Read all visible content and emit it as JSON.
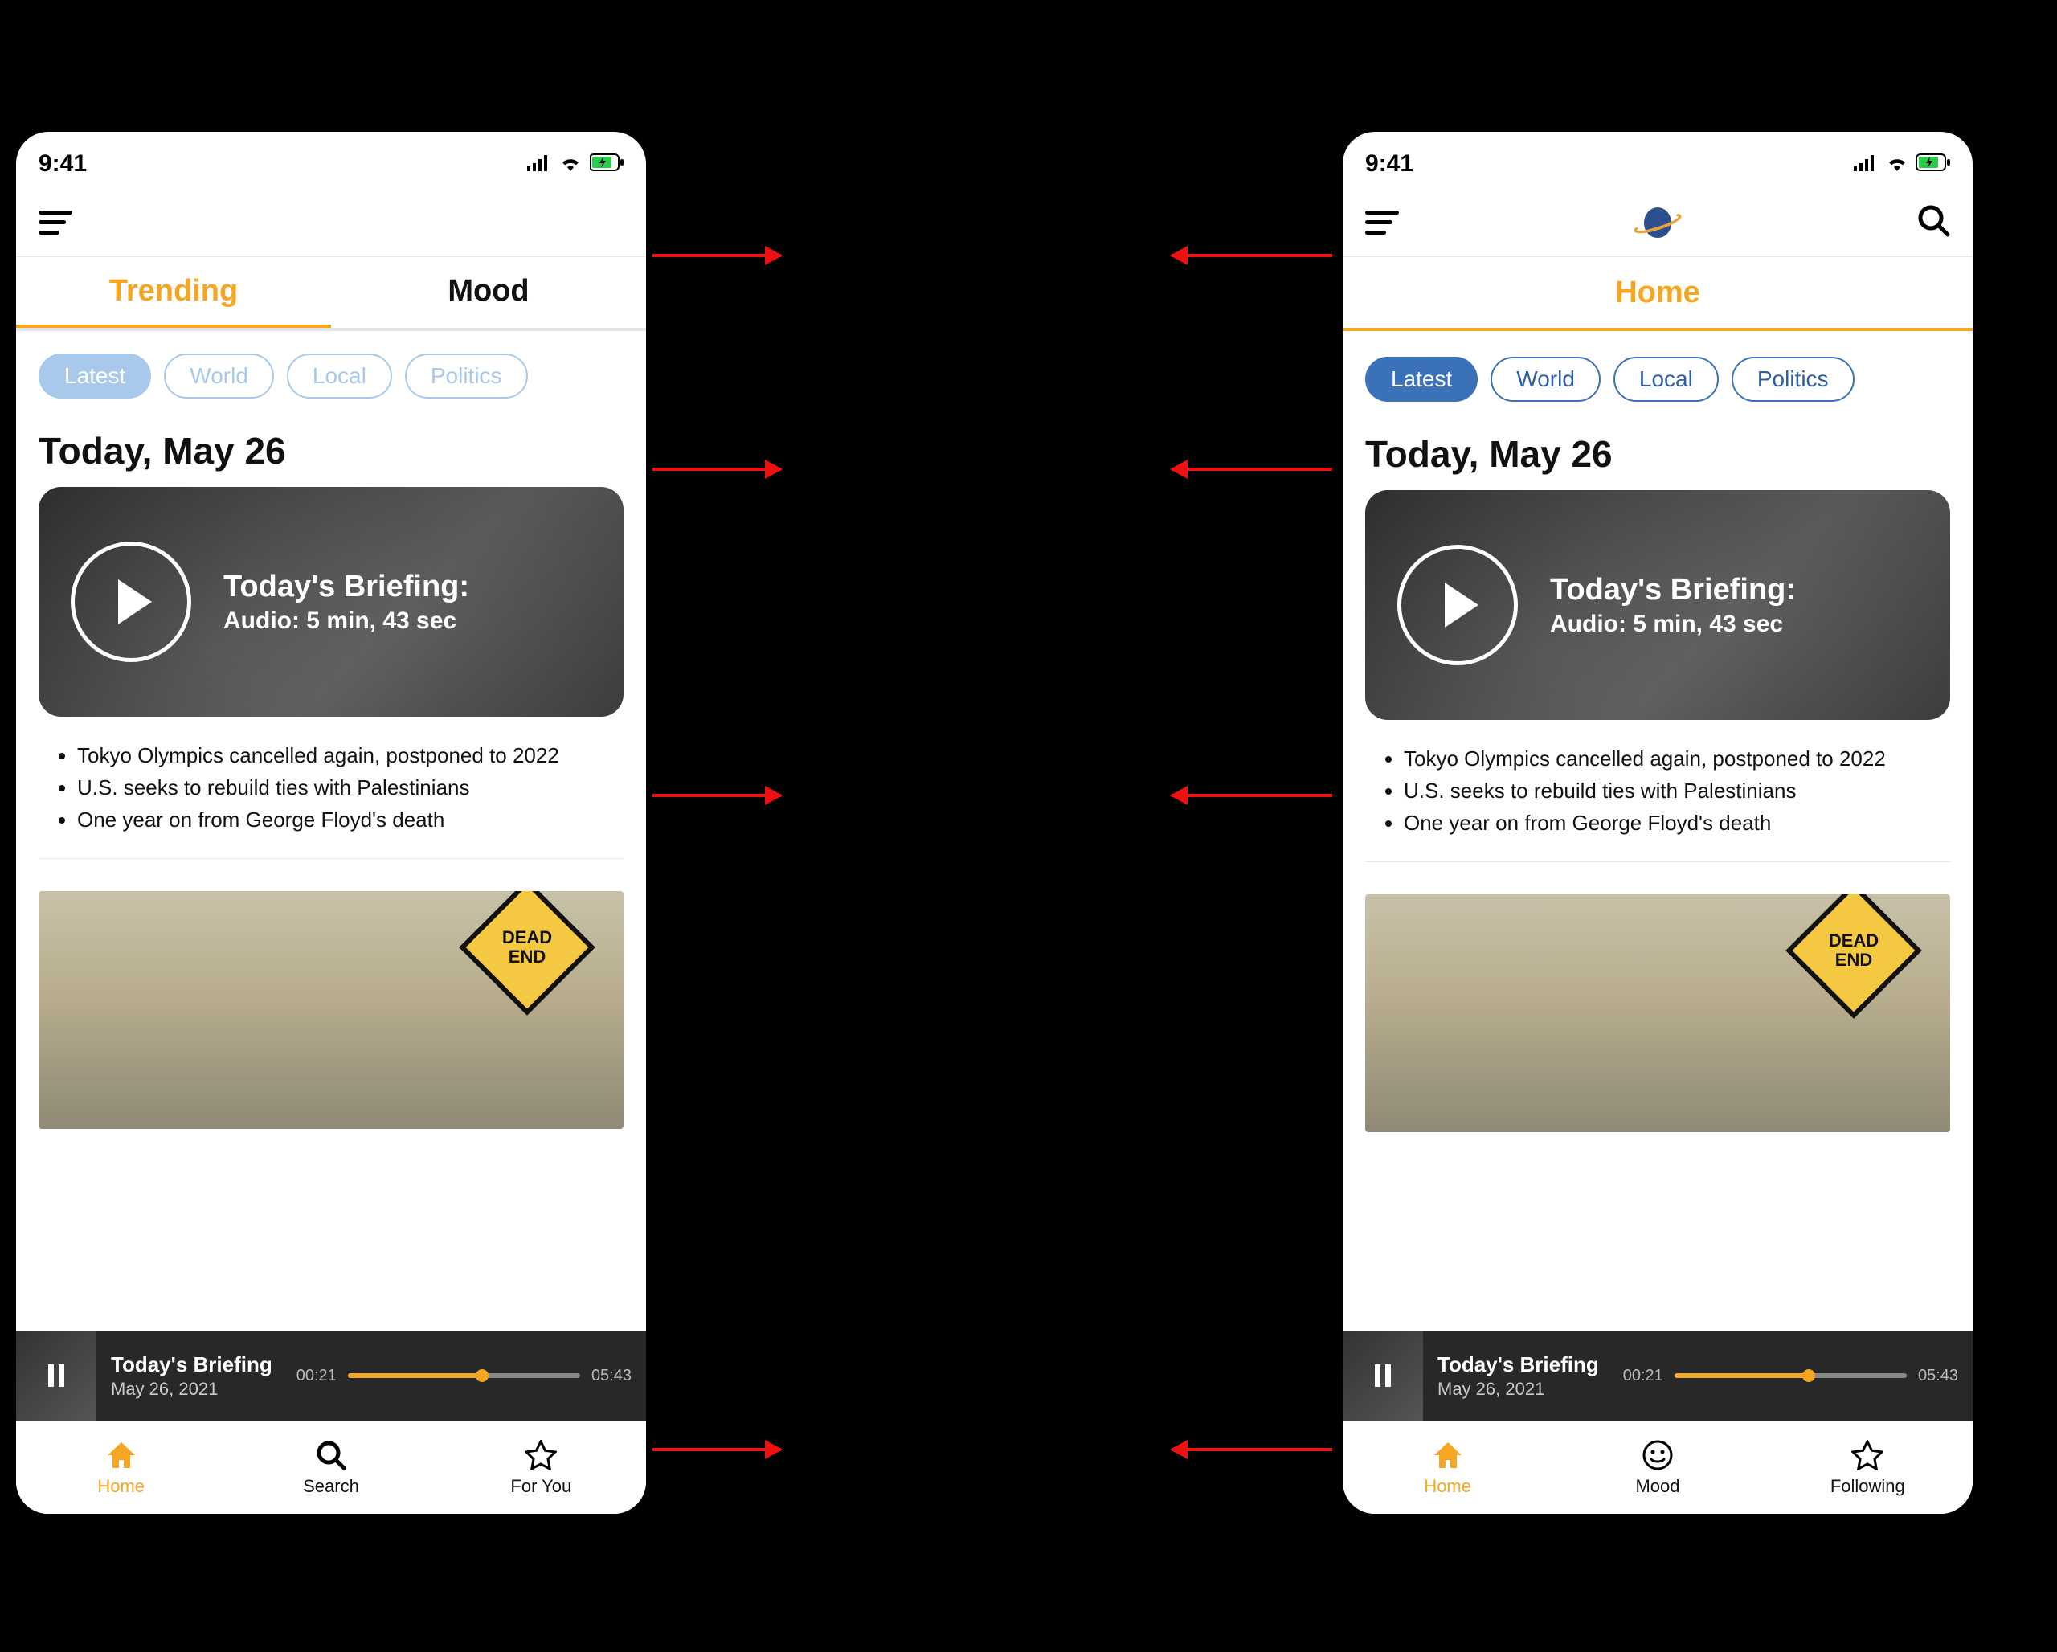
{
  "statusbar": {
    "time": "9:41"
  },
  "shared": {
    "chips": [
      "Latest",
      "World",
      "Local",
      "Politics"
    ],
    "date_heading": "Today, May 26",
    "briefing": {
      "title": "Today's Briefing:",
      "subtitle": "Audio: 5 min, 43 sec"
    },
    "bullets": [
      "Tokyo Olympics cancelled again, postponed to 2022",
      "U.S. seeks to rebuild ties with Palestinians",
      "One year on from George Floyd's death"
    ],
    "sign": "DEAD END",
    "player": {
      "title": "Today's Briefing",
      "date": "May 26, 2021",
      "elapsed": "00:21",
      "total": "05:43",
      "progress_pct": 58
    }
  },
  "left_screen": {
    "tabs": [
      {
        "label": "Trending",
        "active": true
      },
      {
        "label": "Mood",
        "active": false
      }
    ],
    "bottom_nav": [
      {
        "label": "Home",
        "icon": "home",
        "active": true
      },
      {
        "label": "Search",
        "icon": "search",
        "active": false
      },
      {
        "label": "For You",
        "icon": "star",
        "active": false
      }
    ]
  },
  "right_screen": {
    "title": "Home",
    "bottom_nav": [
      {
        "label": "Home",
        "icon": "home",
        "active": true
      },
      {
        "label": "Mood",
        "icon": "smile",
        "active": false
      },
      {
        "label": "Following",
        "icon": "star",
        "active": false
      }
    ]
  }
}
